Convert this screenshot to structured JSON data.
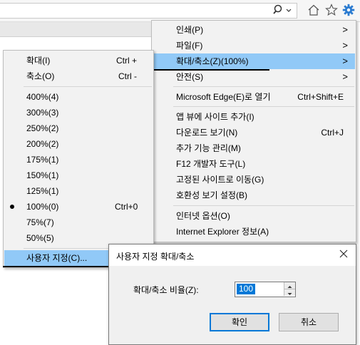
{
  "tools_menu": {
    "items": [
      {
        "label": "인쇄(P)",
        "arrow": ">"
      },
      {
        "label": "파일(F)",
        "arrow": ">"
      },
      {
        "label": "확대/축소(Z)(100%)",
        "arrow": ">"
      },
      {
        "label": "안전(S)",
        "arrow": ">"
      },
      {
        "label": "Microsoft Edge(E)로 열기",
        "shortcut": "Ctrl+Shift+E"
      },
      {
        "label": "앱 뷰에 사이트 추가(I)"
      },
      {
        "label": "다운로드 보기(N)",
        "shortcut": "Ctrl+J"
      },
      {
        "label": "추가 기능 관리(M)"
      },
      {
        "label": "F12 개발자 도구(L)"
      },
      {
        "label": "고정된 사이트로 이동(G)"
      },
      {
        "label": "호환성 보기 설정(B)"
      },
      {
        "label": "인터넷 옵션(O)"
      },
      {
        "label": "Internet Explorer 정보(A)"
      }
    ]
  },
  "zoom_menu": {
    "items": [
      {
        "label": "확대(I)",
        "shortcut": "Ctrl +"
      },
      {
        "label": "축소(O)",
        "shortcut": "Ctrl -"
      },
      {
        "label": "400%(4)"
      },
      {
        "label": "300%(3)"
      },
      {
        "label": "250%(2)"
      },
      {
        "label": "200%(2)"
      },
      {
        "label": "175%(1)"
      },
      {
        "label": "150%(1)"
      },
      {
        "label": "125%(1)"
      },
      {
        "label": "100%(0)",
        "shortcut": "Ctrl+0"
      },
      {
        "label": "75%(7)"
      },
      {
        "label": "50%(5)"
      },
      {
        "label": "사용자 지정(C)..."
      }
    ],
    "selected_index": 9
  },
  "dialog": {
    "title": "사용자 지정 확대/축소",
    "field_label": "확대/축소 비율(Z):",
    "field_value": "100",
    "ok_label": "확인",
    "cancel_label": "취소"
  },
  "toolbar": {
    "icons": [
      "search-icon",
      "dropdown-icon",
      "home-icon",
      "favorites-star-icon",
      "tools-gear-icon"
    ],
    "accent_color": "#2b7bd0"
  },
  "colors": {
    "highlight": "#91c9f7",
    "menu_bg": "#f2f2f2",
    "dialog_bg": "#f0f0f0",
    "default_button_border": "#0078d7"
  }
}
